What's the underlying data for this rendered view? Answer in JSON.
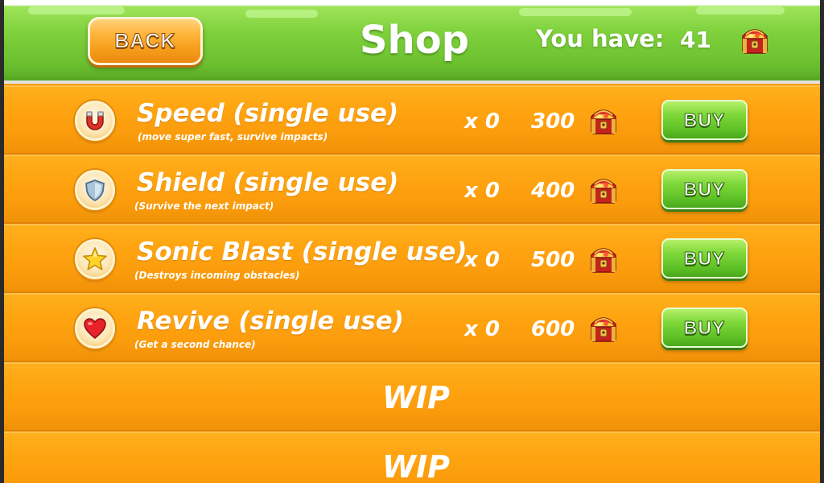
{
  "header": {
    "back_label": "BACK",
    "title": "Shop",
    "balance_label": "You have:",
    "balance_value": "41",
    "currency_icon": "treasure-chest-icon"
  },
  "colors": {
    "header_green": "#6cc02f",
    "row_orange": "#ffa512",
    "back_orange": "#f59c1a",
    "buy_green": "#5fc127",
    "text_white": "#ffffff"
  },
  "items": [
    {
      "name": "Speed (single use)",
      "description": "(move super fast, survive impacts)",
      "icon": "magnet-icon",
      "count": "x 0",
      "price": "300",
      "buy_label": "BUY"
    },
    {
      "name": "Shield (single use)",
      "description": "(Survive the next impact)",
      "icon": "shield-icon",
      "count": "x 0",
      "price": "400",
      "buy_label": "BUY"
    },
    {
      "name": "Sonic Blast (single use)",
      "description": "(Destroys incoming obstacles)",
      "icon": "star-icon",
      "count": "x 0",
      "price": "500",
      "buy_label": "BUY"
    },
    {
      "name": "Revive (single use)",
      "description": "(Get a second chance)",
      "icon": "heart-icon",
      "count": "x 0",
      "price": "600",
      "buy_label": "BUY"
    }
  ],
  "placeholders": [
    {
      "label": "WIP"
    },
    {
      "label": "WIP"
    }
  ]
}
